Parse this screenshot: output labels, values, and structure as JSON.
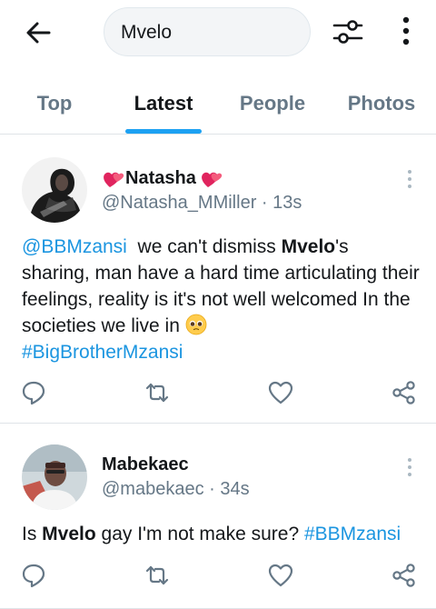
{
  "search": {
    "value": "Mvelo"
  },
  "tabs": [
    {
      "label": "Top"
    },
    {
      "label": "Latest"
    },
    {
      "label": "People"
    },
    {
      "label": "Photos"
    }
  ],
  "tweets": [
    {
      "name": "Natasha",
      "handle": "@Natasha_MMiller",
      "separator": "·",
      "time": "13s",
      "text_parts": {
        "mention": "@BBMzansi",
        "t1": "  we can't dismiss ",
        "bold": "Mvelo",
        "t2": "'s sharing, man have a hard time articulating their feelings, reality is it's not well welcomed In the societies we live in ",
        "hashtag": "#BigBrotherMzansi"
      }
    },
    {
      "name": "Mabekaec",
      "handle": "@mabekaec",
      "separator": "·",
      "time": "34s",
      "text_parts": {
        "t1": "Is ",
        "bold": "Mvelo",
        "t2": " gay I'm not make sure? ",
        "hashtag": "#BBMzansi"
      }
    }
  ],
  "icons": {
    "back": "arrow-left-icon",
    "filter": "filter-sliders-icon",
    "more": "more-vertical-icon",
    "reply": "reply-icon",
    "retweet": "retweet-icon",
    "like": "heart-icon",
    "share": "share-icon"
  },
  "colors": {
    "accent": "#1da1f2",
    "link": "#1b95e0",
    "muted": "#657786",
    "heart_emoji": "#e0245e"
  }
}
